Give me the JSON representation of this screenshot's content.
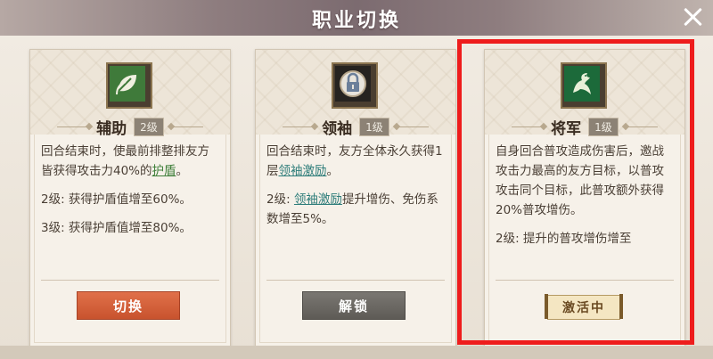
{
  "window": {
    "title": "职业切换"
  },
  "cards": [
    {
      "name": "辅助",
      "level": "2级",
      "desc_lines": [
        {
          "prefix": "回合结束时，使最前排整排友方皆获得攻击力40%的",
          "link": "护盾",
          "suffix": "。"
        },
        {
          "prefix": "2级: 获得护盾值增至60%。",
          "link": "",
          "suffix": ""
        },
        {
          "prefix": "3级: 获得护盾值增至80%。",
          "link": "",
          "suffix": ""
        }
      ],
      "action_label": "切换",
      "icon": "leaf-icon"
    },
    {
      "name": "领袖",
      "level": "1级",
      "desc_lines": [
        {
          "prefix": "回合结束时，友方全体永久获得1层",
          "link": "领袖激励",
          "suffix": "。"
        },
        {
          "prefix": "2级: ",
          "link": "领袖激励",
          "suffix": "提升增伤、免伤系数增至5%。"
        }
      ],
      "action_label": "解锁",
      "icon": "lock-icon"
    },
    {
      "name": "将军",
      "level": "1级",
      "desc_lines": [
        {
          "prefix": "自身回合普攻造成伤害后，邀战攻击力最高的友方目标，以普攻攻击同个目标，此普攻额外获得20%普攻增伤。",
          "link": "",
          "suffix": ""
        },
        {
          "prefix": "2级: 提升的普攻增伤增至",
          "link": "",
          "suffix": ""
        }
      ],
      "action_label": "激活中",
      "icon": "dragon-icon"
    }
  ],
  "colors": {
    "accent_red": "#ee1c1c",
    "switch_button": "#d55f3b",
    "unlock_button": "#6b6863"
  }
}
